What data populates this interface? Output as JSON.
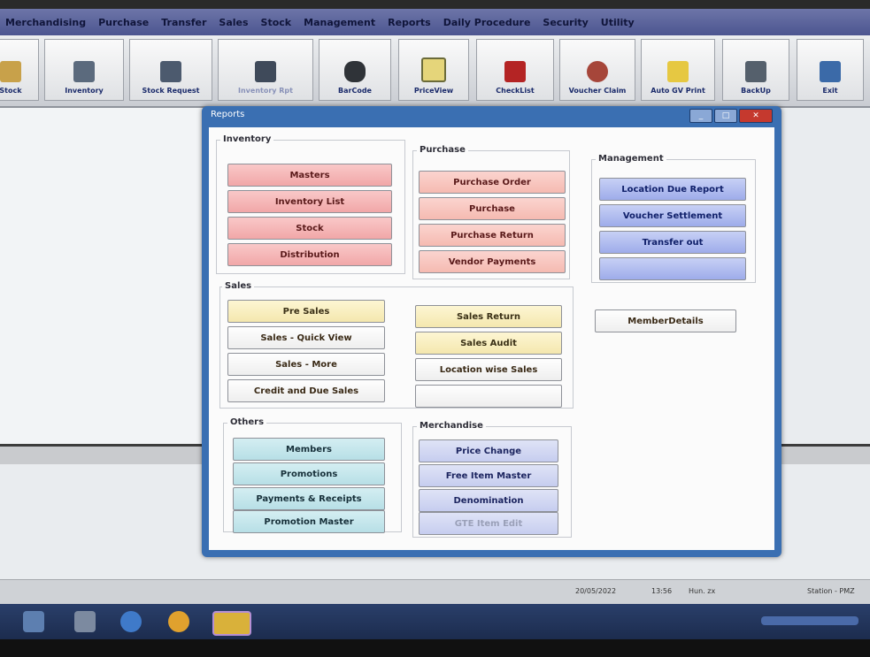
{
  "menubar": [
    "Merchandising",
    "Purchase",
    "Transfer",
    "Sales",
    "Stock",
    "Management",
    "Reports",
    "Daily Procedure",
    "Security",
    "Utility"
  ],
  "toolbar": [
    {
      "label": "Stock",
      "icon": "box-icon"
    },
    {
      "label": "Inventory",
      "icon": "inventory-icon"
    },
    {
      "label": "Stock Request",
      "icon": "stock-request-icon"
    },
    {
      "label": "Inventory Rpt",
      "icon": "report-icon"
    },
    {
      "label": "BarCode",
      "icon": "barcode-printer-icon"
    },
    {
      "label": "PriceView",
      "icon": "price-view-icon"
    },
    {
      "label": "CheckList",
      "icon": "checklist-icon"
    },
    {
      "label": "Voucher Claim",
      "icon": "voucher-icon"
    },
    {
      "label": "Auto GV Print",
      "icon": "gv-print-icon"
    },
    {
      "label": "BackUp",
      "icon": "backup-icon"
    },
    {
      "label": "Exit",
      "icon": "exit-icon"
    }
  ],
  "window": {
    "title": "Reports",
    "groups": {
      "inventory": {
        "title": "Inventory",
        "buttons": [
          "Masters",
          "Inventory List",
          "Stock",
          "Distribution"
        ]
      },
      "purchase": {
        "title": "Purchase",
        "buttons": [
          "Purchase Order",
          "Purchase",
          "Purchase Return",
          "Vendor Payments"
        ]
      },
      "management": {
        "title": "Management",
        "buttons": [
          "Location Due Report",
          "Voucher Settlement",
          "Transfer out",
          ""
        ]
      },
      "sales": {
        "title": "Sales",
        "buttons_left": [
          "Pre Sales",
          "Sales - Quick View",
          "Sales - More",
          "Credit and Due Sales"
        ],
        "buttons_mid": [
          "Sales Return",
          "Sales Audit",
          "Location wise Sales",
          ""
        ],
        "buttons_right": [
          "MemberDetails"
        ]
      },
      "others": {
        "title": "Others",
        "buttons": [
          "Members",
          "Promotions",
          "Payments & Receipts",
          "Promotion Master"
        ]
      },
      "merchandise": {
        "title": "Merchandise",
        "buttons": [
          "Price Change",
          "Free Item Master",
          "Denomination",
          "GTE Item Edit"
        ]
      }
    }
  },
  "status": {
    "date": "20/05/2022",
    "time": "13:56",
    "extra": "Hun. zx",
    "right": "Station - PMZ"
  }
}
